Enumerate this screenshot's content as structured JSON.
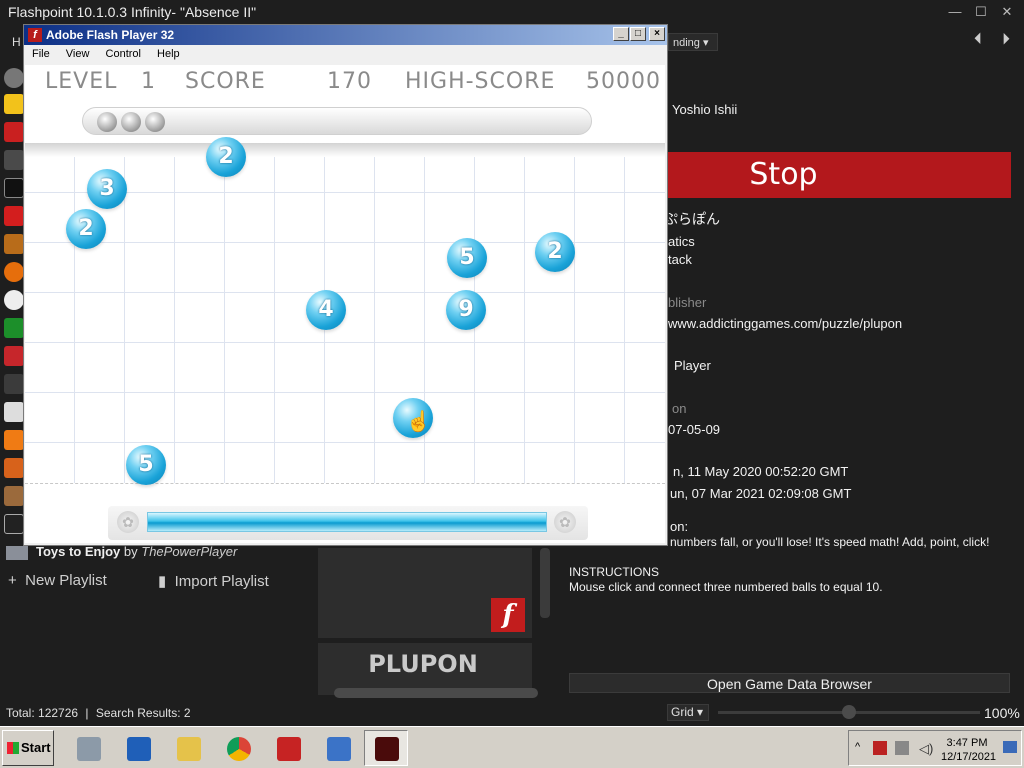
{
  "app": {
    "title": "Flashpoint 10.1.0.3 Infinity- \"Absence II\"",
    "menu_stub": "H"
  },
  "window_controls": {
    "minimize": "—",
    "maximize": "☐",
    "close": "✕"
  },
  "header": {
    "sort_value": "nding",
    "nav_left": "⏴",
    "nav_right": "⏵"
  },
  "game_info": {
    "developer": "Yoshio Ishii",
    "stop_label": "Stop",
    "alt_title": "ぷらぽん",
    "tags_1": "atics",
    "tags_2": "tack",
    "publisher_label": "blisher",
    "source": "www.addictinggames.com/puzzle/plupon",
    "platform": "Player",
    "version_label": "on",
    "release_date": "07-05-09",
    "date_added": "n, 11 May 2020 00:52:20 GMT",
    "date_modified": "un, 07 Mar 2021 02:09:08 GMT",
    "notes_label": "on:",
    "notes": "numbers fall, or you'll lose! It's speed math! Add, point, click!",
    "instructions_label": "INSTRUCTIONS",
    "instructions": "Mouse click and connect three numbered balls to equal 10.",
    "open_browser": "Open Game Data Browser"
  },
  "middle": {
    "game_title": "PLUPON",
    "flash_logo": "f"
  },
  "playlist": {
    "name": "Toys to Enjoy",
    "by": "by",
    "author": "ThePowerPlayer",
    "new_playlist": "New Playlist",
    "import_playlist": "Import Playlist"
  },
  "status": {
    "total": "Total: 122726",
    "separator": "|",
    "search_results": "Search Results: 2",
    "view_mode": "Grid",
    "zoom": "100%",
    "zoom_level": 0.5
  },
  "flash_window": {
    "title": "Adobe Flash Player 32",
    "menu": [
      "File",
      "View",
      "Control",
      "Help"
    ]
  },
  "game": {
    "level_label": "LEVEL",
    "level_value": "1",
    "score_label": "SCORE",
    "score_value": "170",
    "highscore_label": "HIGH-SCORE",
    "highscore_value": "50000",
    "balls": [
      "2",
      "3",
      "2",
      "5",
      "2",
      "4",
      "9",
      "5",
      ""
    ],
    "timer_fill": 1.0
  },
  "taskbar": {
    "start": "Start",
    "clock_time": "3:47 PM",
    "clock_date": "12/17/2021"
  }
}
